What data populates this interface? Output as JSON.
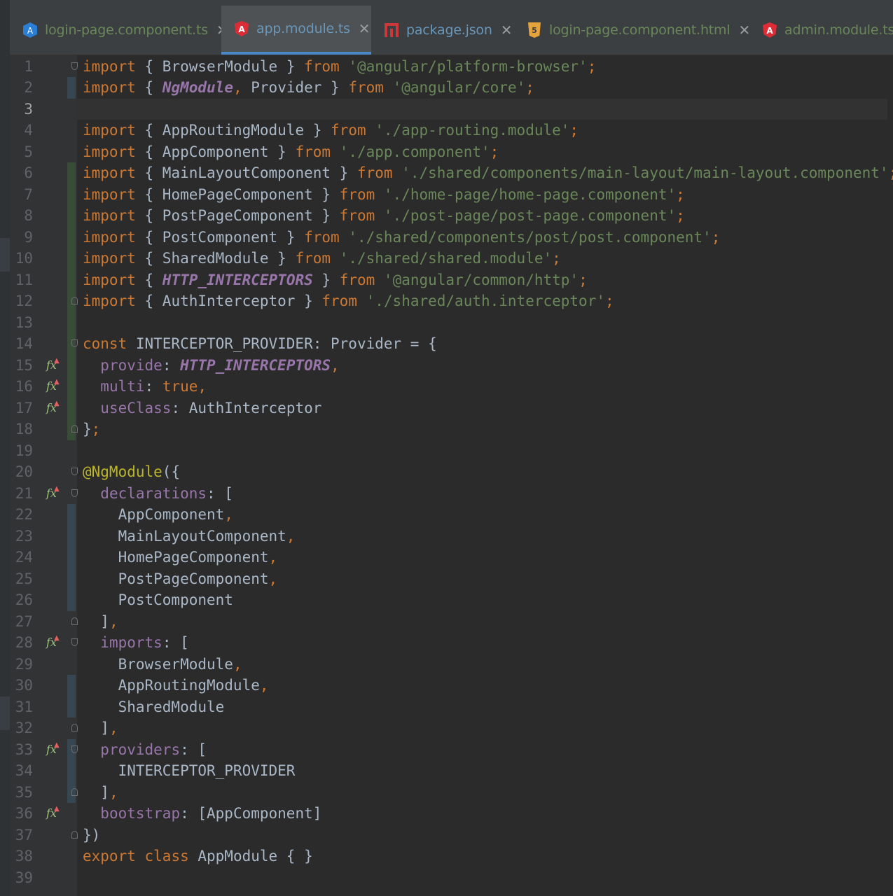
{
  "tabs": [
    {
      "label": "login-page.component.ts",
      "icon": "angular-ts-icon",
      "icon_color": "#2a7fd4",
      "color": "#6a8759",
      "active": false
    },
    {
      "label": "app.module.ts",
      "icon": "angular-icon",
      "icon_color": "#dd2c36",
      "color": "#6897bb",
      "active": true
    },
    {
      "label": "package.json",
      "icon": "npm-icon",
      "icon_color": "#cb3837",
      "color": "#6897bb",
      "active": false
    },
    {
      "label": "login-page.component.html",
      "icon": "html5-icon",
      "icon_color": "#e5a33b",
      "color": "#6a8759",
      "active": false
    },
    {
      "label": "admin.module.ts",
      "icon": "angular-icon",
      "icon_color": "#dd2c36",
      "color": "#6a8759",
      "active": false
    }
  ],
  "close_symbol": "✕",
  "gutter_icon_symbol": "fx",
  "current_line": 3,
  "lines": [
    {
      "n": "1",
      "tokens": [
        [
          "kw",
          "import"
        ],
        [
          "",
          "{ BrowserModule } "
        ],
        [
          "kw",
          "from"
        ],
        [
          "",
          " "
        ],
        [
          "str",
          "'@angular/platform-browser'"
        ],
        [
          "punc",
          ";"
        ]
      ]
    },
    {
      "n": "2",
      "tokens": [
        [
          "kw",
          "import"
        ],
        [
          "",
          "{ "
        ],
        [
          "ital",
          "NgModule"
        ],
        [
          "punc",
          ","
        ],
        [
          "",
          " Provider } "
        ],
        [
          "kw",
          "from"
        ],
        [
          "",
          " "
        ],
        [
          "str",
          "'@angular/core'"
        ],
        [
          "punc",
          ";"
        ]
      ]
    },
    {
      "n": "3",
      "tokens": []
    },
    {
      "n": "4",
      "tokens": [
        [
          "kw",
          "import"
        ],
        [
          "",
          "{ AppRoutingModule } "
        ],
        [
          "kw",
          "from"
        ],
        [
          "",
          " "
        ],
        [
          "str",
          "'./app-routing.module'"
        ],
        [
          "punc",
          ";"
        ]
      ]
    },
    {
      "n": "5",
      "tokens": [
        [
          "kw",
          "import"
        ],
        [
          "",
          "{ AppComponent } "
        ],
        [
          "kw",
          "from"
        ],
        [
          "",
          " "
        ],
        [
          "str",
          "'./app.component'"
        ],
        [
          "punc",
          ";"
        ]
      ]
    },
    {
      "n": "6",
      "tokens": [
        [
          "kw",
          "import"
        ],
        [
          "",
          "{ MainLayoutComponent } "
        ],
        [
          "kw",
          "from"
        ],
        [
          "",
          " "
        ],
        [
          "str",
          "'./shared/components/main-layout/main-layout.component'"
        ],
        [
          "punc",
          ";"
        ]
      ]
    },
    {
      "n": "7",
      "tokens": [
        [
          "kw",
          "import"
        ],
        [
          "",
          "{ HomePageComponent } "
        ],
        [
          "kw",
          "from"
        ],
        [
          "",
          " "
        ],
        [
          "str",
          "'./home-page/home-page.component'"
        ],
        [
          "punc",
          ";"
        ]
      ]
    },
    {
      "n": "8",
      "tokens": [
        [
          "kw",
          "import"
        ],
        [
          "",
          "{ PostPageComponent } "
        ],
        [
          "kw",
          "from"
        ],
        [
          "",
          " "
        ],
        [
          "str",
          "'./post-page/post-page.component'"
        ],
        [
          "punc",
          ";"
        ]
      ]
    },
    {
      "n": "9",
      "tokens": [
        [
          "kw",
          "import"
        ],
        [
          "",
          "{ PostComponent } "
        ],
        [
          "kw",
          "from"
        ],
        [
          "",
          " "
        ],
        [
          "str",
          "'./shared/components/post/post.component'"
        ],
        [
          "punc",
          ";"
        ]
      ]
    },
    {
      "n": "10",
      "tokens": [
        [
          "kw",
          "import"
        ],
        [
          "",
          "{ SharedModule } "
        ],
        [
          "kw",
          "from"
        ],
        [
          "",
          " "
        ],
        [
          "str",
          "'./shared/shared.module'"
        ],
        [
          "punc",
          ";"
        ]
      ]
    },
    {
      "n": "11",
      "tokens": [
        [
          "kw",
          "import"
        ],
        [
          "",
          "{ "
        ],
        [
          "ital",
          "HTTP_INTERCEPTORS"
        ],
        [
          "",
          " } "
        ],
        [
          "kw",
          "from"
        ],
        [
          "",
          " "
        ],
        [
          "str",
          "'@angular/common/http'"
        ],
        [
          "punc",
          ";"
        ]
      ]
    },
    {
      "n": "12",
      "tokens": [
        [
          "kw",
          "import"
        ],
        [
          "",
          "{ AuthInterceptor } "
        ],
        [
          "kw",
          "from"
        ],
        [
          "",
          " "
        ],
        [
          "str",
          "'./shared/auth.interceptor'"
        ],
        [
          "punc",
          ";"
        ]
      ]
    },
    {
      "n": "13",
      "tokens": []
    },
    {
      "n": "14",
      "tokens": [
        [
          "kw",
          "const"
        ],
        [
          "",
          " INTERCEPTOR_PROVIDER: Provider = {"
        ]
      ]
    },
    {
      "n": "15",
      "tokens": [
        [
          "",
          "  "
        ],
        [
          "prop",
          "provide"
        ],
        [
          "",
          ": "
        ],
        [
          "ital",
          "HTTP_INTERCEPTORS"
        ],
        [
          "punc",
          ","
        ]
      ]
    },
    {
      "n": "16",
      "tokens": [
        [
          "",
          "  "
        ],
        [
          "prop",
          "multi"
        ],
        [
          "",
          ": "
        ],
        [
          "kw",
          "true"
        ],
        [
          "punc",
          ","
        ]
      ]
    },
    {
      "n": "17",
      "tokens": [
        [
          "",
          "  "
        ],
        [
          "prop",
          "useClass"
        ],
        [
          "",
          ": AuthInterceptor"
        ]
      ]
    },
    {
      "n": "18",
      "tokens": [
        [
          "",
          "}"
        ],
        [
          "punc",
          ";"
        ]
      ]
    },
    {
      "n": "19",
      "tokens": []
    },
    {
      "n": "20",
      "tokens": [
        [
          "ann",
          "@NgModule"
        ],
        [
          "",
          "({"
        ]
      ]
    },
    {
      "n": "21",
      "tokens": [
        [
          "",
          "  "
        ],
        [
          "prop",
          "declarations"
        ],
        [
          "",
          ": ["
        ]
      ]
    },
    {
      "n": "22",
      "tokens": [
        [
          "",
          "    AppComponent"
        ],
        [
          "punc",
          ","
        ]
      ]
    },
    {
      "n": "23",
      "tokens": [
        [
          "",
          "    MainLayoutComponent"
        ],
        [
          "punc",
          ","
        ]
      ]
    },
    {
      "n": "24",
      "tokens": [
        [
          "",
          "    HomePageComponent"
        ],
        [
          "punc",
          ","
        ]
      ]
    },
    {
      "n": "25",
      "tokens": [
        [
          "",
          "    PostPageComponent"
        ],
        [
          "punc",
          ","
        ]
      ]
    },
    {
      "n": "26",
      "tokens": [
        [
          "",
          "    PostComponent"
        ]
      ]
    },
    {
      "n": "27",
      "tokens": [
        [
          "",
          "  ]"
        ],
        [
          "punc",
          ","
        ]
      ]
    },
    {
      "n": "28",
      "tokens": [
        [
          "",
          "  "
        ],
        [
          "prop",
          "imports"
        ],
        [
          "",
          ": ["
        ]
      ]
    },
    {
      "n": "29",
      "tokens": [
        [
          "",
          "    BrowserModule"
        ],
        [
          "punc",
          ","
        ]
      ]
    },
    {
      "n": "30",
      "tokens": [
        [
          "",
          "    AppRoutingModule"
        ],
        [
          "punc",
          ","
        ]
      ]
    },
    {
      "n": "31",
      "tokens": [
        [
          "",
          "    SharedModule"
        ]
      ]
    },
    {
      "n": "32",
      "tokens": [
        [
          "",
          "  ]"
        ],
        [
          "punc",
          ","
        ]
      ]
    },
    {
      "n": "33",
      "tokens": [
        [
          "",
          "  "
        ],
        [
          "prop",
          "providers"
        ],
        [
          "",
          ": ["
        ]
      ]
    },
    {
      "n": "34",
      "tokens": [
        [
          "",
          "    INTERCEPTOR_PROVIDER"
        ]
      ]
    },
    {
      "n": "35",
      "tokens": [
        [
          "",
          "  ]"
        ],
        [
          "punc",
          ","
        ]
      ]
    },
    {
      "n": "36",
      "tokens": [
        [
          "",
          "  "
        ],
        [
          "prop",
          "bootstrap"
        ],
        [
          "",
          ": [AppComponent]"
        ]
      ]
    },
    {
      "n": "37",
      "tokens": [
        [
          "",
          "})"
        ]
      ]
    },
    {
      "n": "38",
      "tokens": [
        [
          "kw",
          "export"
        ],
        [
          "",
          " "
        ],
        [
          "kw",
          "class"
        ],
        [
          "",
          " AppModule { }"
        ]
      ]
    },
    {
      "n": "39",
      "tokens": []
    }
  ]
}
